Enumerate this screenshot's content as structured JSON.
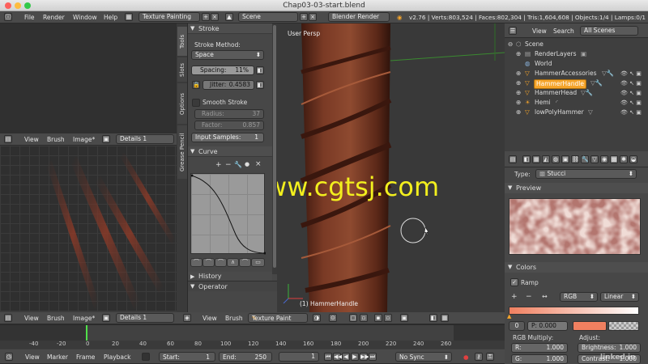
{
  "window": {
    "title": "Chap03-03-start.blend"
  },
  "topbar": {
    "menus": [
      "File",
      "Render",
      "Window",
      "Help"
    ],
    "layout": "Texture Painting",
    "scene": "Scene",
    "engine": "Blender Render",
    "stats": "v2.76 | Verts:803,524 | Faces:802,304 | Tris:1,604,608 | Objects:1/4 | Lamps:0/1 | Mem:"
  },
  "uv_editor": {
    "menus": [
      "View",
      "Brush",
      "Image*"
    ],
    "image": "Details 1"
  },
  "bottom_uv": {
    "menus": [
      "View",
      "Brush",
      "Image*"
    ],
    "image": "Details 1"
  },
  "toolshelf": {
    "tabs": [
      "Tools",
      "Slots",
      "Options",
      "Grease Pencil"
    ],
    "stroke_title": "Stroke",
    "stroke_method_label": "Stroke Method:",
    "stroke_method": "Space",
    "spacing": "Spacing:",
    "spacing_value": "11%",
    "jitter": "Jitter:",
    "jitter_value": "0.4583",
    "smooth": "Smooth Stroke",
    "radius": "Radius:",
    "radius_value": "37",
    "factor": "Factor:",
    "factor_value": "0.857",
    "input_samples": "Input Samples:",
    "input_samples_value": "1",
    "curve_title": "Curve",
    "curve_tools": [
      "+",
      "−",
      "🔧",
      "●",
      "×"
    ],
    "history": "History",
    "operator": "Operator"
  },
  "viewport": {
    "label": "User Persp",
    "object": "(1) HammerHandle",
    "watermark": "www.cgtsj.com",
    "menus": [
      "View",
      "Brush"
    ],
    "mode": "Texture Paint"
  },
  "outliner": {
    "menus": [
      "View",
      "Search"
    ],
    "filter": "All Scenes",
    "items": [
      {
        "name": "Scene",
        "indent": 0
      },
      {
        "name": "RenderLayers",
        "indent": 1
      },
      {
        "name": "World",
        "indent": 1
      },
      {
        "name": "HammerAccessories",
        "indent": 1
      },
      {
        "name": "HammerHandle",
        "indent": 1,
        "selected": true
      },
      {
        "name": "HammerHead",
        "indent": 1
      },
      {
        "name": "Hemi",
        "indent": 1
      },
      {
        "name": "lowPolyHammer",
        "indent": 1
      }
    ]
  },
  "properties": {
    "type_label": "Type:",
    "type_value": "Stucci",
    "preview": "Preview",
    "colors": "Colors",
    "ramp": "Ramp",
    "ramp_plus": "+",
    "ramp_minus": "−",
    "ramp_flip": "↔",
    "ramp_mode": "RGB",
    "ramp_interp": "Linear",
    "ramp_index": "0",
    "ramp_pos": "P: 0.000",
    "rgb_multiply": "RGB Multiply:",
    "r": "R:",
    "r_value": "1.000",
    "g": "G:",
    "g_value": "1.000",
    "adjust": "Adjust:",
    "brightness": "Brightness:",
    "brightness_value": "1.000",
    "contrast": "Contrast:",
    "contrast_value": "1.000"
  },
  "timeline": {
    "ticks": [
      "-40",
      "-20",
      "0",
      "20",
      "40",
      "60",
      "80",
      "100",
      "120",
      "140",
      "160",
      "180",
      "200",
      "220",
      "240",
      "260"
    ],
    "menus": [
      "View",
      "Marker",
      "Frame",
      "Playback"
    ],
    "start_label": "Start:",
    "start": "1",
    "end_label": "End:",
    "end": "250",
    "current": "1",
    "sync": "No Sync",
    "badge": "linked in"
  },
  "colors": {
    "accent": "#f5a42a",
    "watermark": "#f2ef1e",
    "wood": "#7a3a25",
    "ramp_color": "#f08060"
  }
}
